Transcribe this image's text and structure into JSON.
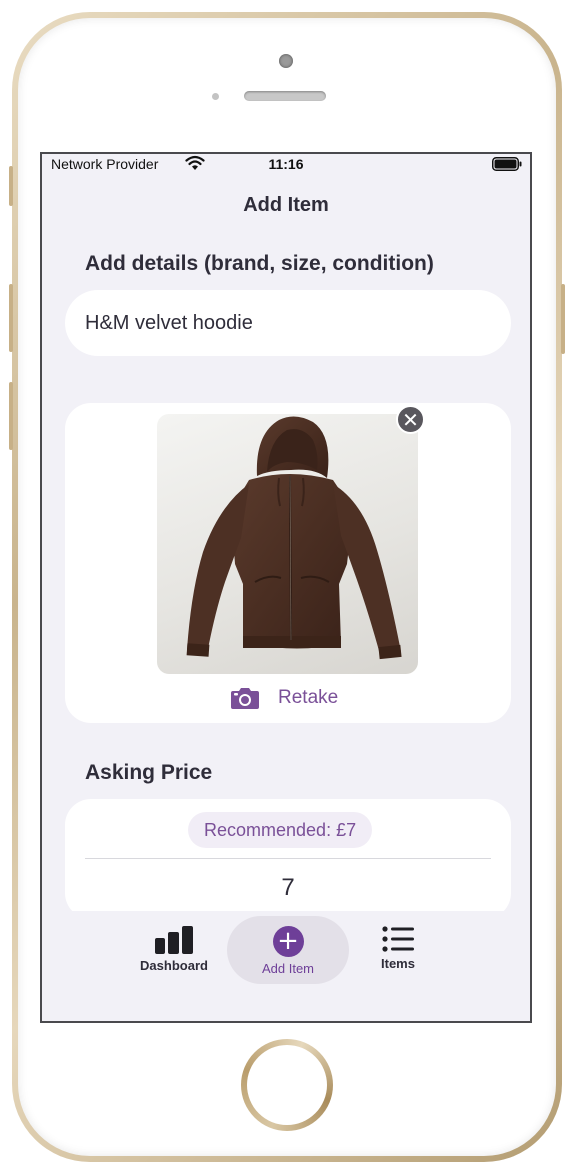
{
  "status_bar": {
    "carrier": "Network Provider",
    "time": "11:16"
  },
  "screen": {
    "title": "Add Item"
  },
  "details": {
    "label": "Add details (brand, size, condition)",
    "value": "H&M velvet hoodie"
  },
  "photo": {
    "retake_label": "Retake",
    "remove_symbol": "✕"
  },
  "price": {
    "label": "Asking Price",
    "recommended": "Recommended: £7",
    "value": "7"
  },
  "tab_bar": {
    "tabs": [
      {
        "label": "Dashboard",
        "icon": "bar-chart-icon"
      },
      {
        "label": "Add Item",
        "icon": "plus-circle-icon",
        "active": true
      },
      {
        "label": "Items",
        "icon": "list-icon"
      }
    ]
  },
  "colors": {
    "accent": "#6e3f98",
    "accent_text": "#7a5098",
    "background": "#f2f1f7",
    "card": "#ffffff",
    "text": "#2f2d3a"
  }
}
